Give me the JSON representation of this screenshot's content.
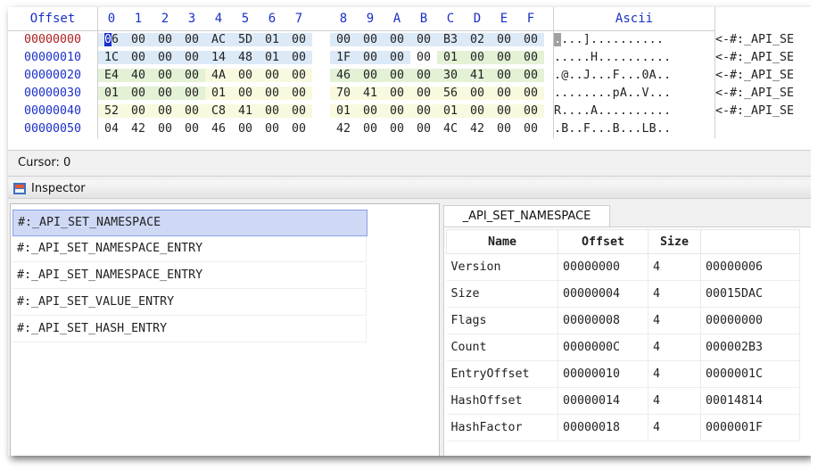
{
  "hex": {
    "offset_header": "Offset",
    "column_headers": [
      "0",
      "1",
      "2",
      "3",
      "4",
      "5",
      "6",
      "7",
      "8",
      "9",
      "A",
      "B",
      "C",
      "D",
      "E",
      "F"
    ],
    "ascii_header": "Ascii",
    "rows": [
      {
        "offset": "00000000",
        "bytes": [
          "06",
          "00",
          "00",
          "00",
          "AC",
          "5D",
          "01",
          "00",
          "00",
          "00",
          "00",
          "00",
          "B3",
          "02",
          "00",
          "00"
        ],
        "ascii": "....]..........",
        "template": "<-#:_API_SE"
      },
      {
        "offset": "00000010",
        "bytes": [
          "1C",
          "00",
          "00",
          "00",
          "14",
          "48",
          "01",
          "00",
          "1F",
          "00",
          "00",
          "00",
          "01",
          "00",
          "00",
          "00"
        ],
        "ascii": ".....H..........",
        "template": "<-#:_API_SE"
      },
      {
        "offset": "00000020",
        "bytes": [
          "E4",
          "40",
          "00",
          "00",
          "4A",
          "00",
          "00",
          "00",
          "46",
          "00",
          "00",
          "00",
          "30",
          "41",
          "00",
          "00"
        ],
        "ascii": ".@..J...F...0A..",
        "template": "<-#:_API_SE"
      },
      {
        "offset": "00000030",
        "bytes": [
          "01",
          "00",
          "00",
          "00",
          "01",
          "00",
          "00",
          "00",
          "70",
          "41",
          "00",
          "00",
          "56",
          "00",
          "00",
          "00"
        ],
        "ascii": "........pA..V...",
        "template": "<-#:_API_SE"
      },
      {
        "offset": "00000040",
        "bytes": [
          "52",
          "00",
          "00",
          "00",
          "C8",
          "41",
          "00",
          "00",
          "01",
          "00",
          "00",
          "00",
          "01",
          "00",
          "00",
          "00"
        ],
        "ascii": "R....A..........",
        "template": "<-#:_API_SE"
      },
      {
        "offset": "00000050",
        "bytes": [
          "04",
          "42",
          "00",
          "00",
          "46",
          "00",
          "00",
          "00",
          "42",
          "00",
          "00",
          "00",
          "4C",
          "42",
          "00",
          "00"
        ],
        "ascii": ".B..F...B...LB..",
        "template": ""
      }
    ]
  },
  "status": {
    "cursor": "Cursor: 0"
  },
  "inspector": {
    "title": "Inspector",
    "list": [
      "#:_API_SET_NAMESPACE",
      "#:_API_SET_NAMESPACE_ENTRY",
      "#:_API_SET_NAMESPACE_ENTRY",
      "#:_API_SET_VALUE_ENTRY",
      "#:_API_SET_HASH_ENTRY"
    ],
    "tab_label": "_API_SET_NAMESPACE",
    "columns": [
      "Name",
      "Offset",
      "Size",
      ""
    ],
    "fields": [
      {
        "name": "Version",
        "offset": "00000000",
        "size": "4",
        "value": "00000006"
      },
      {
        "name": "Size",
        "offset": "00000004",
        "size": "4",
        "value": "00015DAC"
      },
      {
        "name": "Flags",
        "offset": "00000008",
        "size": "4",
        "value": "00000000"
      },
      {
        "name": "Count",
        "offset": "0000000C",
        "size": "4",
        "value": "000002B3"
      },
      {
        "name": "EntryOffset",
        "offset": "00000010",
        "size": "4",
        "value": "0000001C"
      },
      {
        "name": "HashOffset",
        "offset": "00000014",
        "size": "4",
        "value": "00014814"
      },
      {
        "name": "HashFactor",
        "offset": "00000018",
        "size": "4",
        "value": "0000001F"
      }
    ]
  }
}
